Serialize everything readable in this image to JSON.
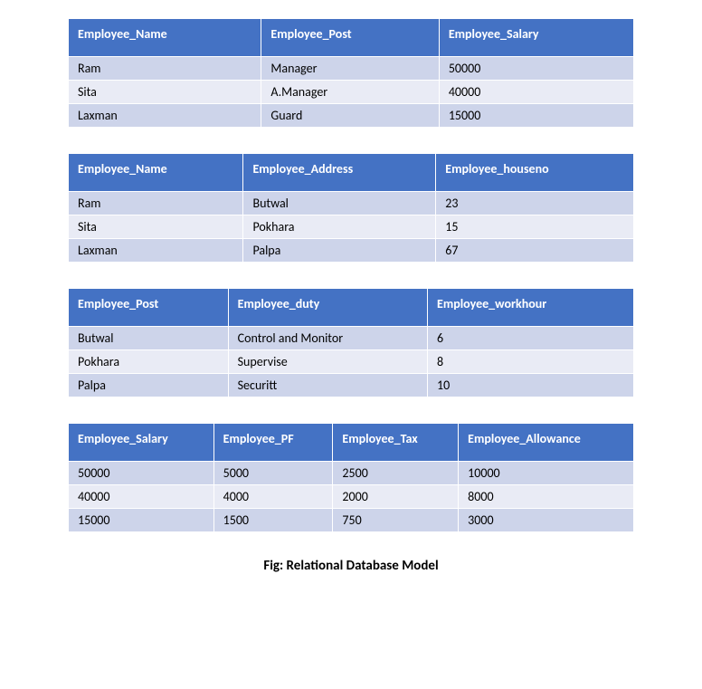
{
  "tables": [
    {
      "headers": [
        "Employee_Name",
        "Employee_Post",
        "Employee_Salary"
      ],
      "rows": [
        [
          "Ram",
          "Manager",
          "50000"
        ],
        [
          "Sita",
          "A.Manager",
          "40000"
        ],
        [
          "Laxman",
          "Guard",
          "15000"
        ]
      ]
    },
    {
      "headers": [
        "Employee_Name",
        "Employee_Address",
        "Employee_houseno"
      ],
      "rows": [
        [
          "Ram",
          "Butwal",
          "23"
        ],
        [
          "Sita",
          "Pokhara",
          "15"
        ],
        [
          "Laxman",
          "Palpa",
          "67"
        ]
      ]
    },
    {
      "headers": [
        "Employee_Post",
        "Employee_duty",
        "Employee_workhour"
      ],
      "rows": [
        [
          "Butwal",
          "Control and Monitor",
          "6"
        ],
        [
          "Pokhara",
          "Supervise",
          "8"
        ],
        [
          "Palpa",
          "Securitt",
          "10"
        ]
      ]
    },
    {
      "headers": [
        "Employee_Salary",
        "Employee_PF",
        "Employee_Tax",
        "Employee_Allowance"
      ],
      "rows": [
        [
          "50000",
          "5000",
          "2500",
          "10000"
        ],
        [
          "40000",
          "4000",
          "2000",
          "8000"
        ],
        [
          "15000",
          "1500",
          "750",
          "3000"
        ]
      ]
    }
  ],
  "caption": "Fig: Relational Database Model"
}
